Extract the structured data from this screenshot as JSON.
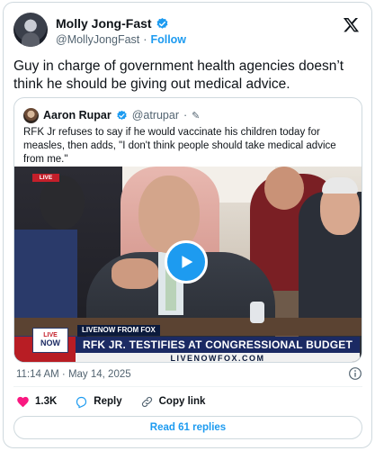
{
  "author": {
    "display_name": "Molly Jong-Fast",
    "handle": "@MollyJongFast",
    "separator": "·",
    "follow_label": "Follow"
  },
  "tweet": {
    "text": "Guy in charge of government health agencies doesn’t think he should be giving out medical advice."
  },
  "quote": {
    "display_name": "Aaron Rupar",
    "handle": "@atrupar",
    "separator": "·",
    "edit_mark": "✎",
    "text": "RFK Jr refuses to say if he would vaccinate his children today for measles, then adds, \"I don't think people should take medical advice from me.\"",
    "video": {
      "live_tag": "LIVE",
      "brand_label": "LIVENOW FROM FOX",
      "logo_top": "LIVE",
      "logo_bottom": "NOW",
      "headline": "RFK JR. TESTIFIES AT CONGRESSIONAL BUDGET HEARING",
      "url": "LIVENOWFOX.COM"
    }
  },
  "timestamp": "11:14 AM · May 14, 2025",
  "actions": {
    "likes": "1.3K",
    "reply_label": "Reply",
    "copy_link_label": "Copy link"
  },
  "read_replies_label": "Read 61 replies",
  "colors": {
    "accent": "#1d9bf0",
    "like": "#f91880",
    "verified": "#1d9bf0",
    "text_secondary": "#536471"
  },
  "icons": [
    "verified-badge-icon",
    "x-logo-icon",
    "pencil-icon",
    "play-icon",
    "info-icon",
    "heart-icon",
    "reply-icon",
    "link-icon"
  ]
}
